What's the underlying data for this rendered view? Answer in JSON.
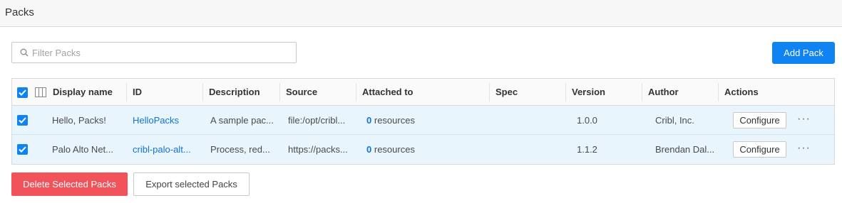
{
  "header": {
    "title": "Packs"
  },
  "filter": {
    "placeholder": "Filter Packs",
    "icon": "search-icon"
  },
  "actions": {
    "add_pack": "Add Pack",
    "delete_selected": "Delete Selected Packs",
    "export_selected": "Export selected Packs"
  },
  "table": {
    "columns": [
      "Display name",
      "ID",
      "Description",
      "Source",
      "Attached to",
      "Spec",
      "Version",
      "Author",
      "Actions"
    ],
    "rows": [
      {
        "selected": true,
        "display_name": "Hello, Packs!",
        "id": "HelloPacks",
        "description": "A sample pac...",
        "source": "file:/opt/cribl...",
        "attached_count": "0",
        "attached_label": "resources",
        "spec": "",
        "version": "1.0.0",
        "author": "Cribl, Inc.",
        "configure": "Configure"
      },
      {
        "selected": true,
        "display_name": "Palo Alto Net...",
        "id": "cribl-palo-alt...",
        "description": "Process, red...",
        "source": "https://packs...",
        "attached_count": "0",
        "attached_label": "resources",
        "spec": "",
        "version": "1.1.2",
        "author": "Brendan Dal...",
        "configure": "Configure"
      }
    ]
  },
  "colors": {
    "primary": "#0f83f3",
    "danger": "#f2535a",
    "selected_row": "#e9f5fc",
    "link": "#0f73d8"
  }
}
